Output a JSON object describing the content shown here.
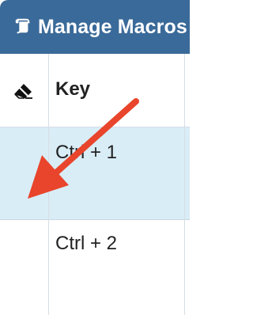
{
  "window": {
    "title": "Manage Macros"
  },
  "icons": {
    "title_icon": "scroll-icon",
    "clear_icon": "eraser-icon"
  },
  "table": {
    "columns": [
      "",
      "Key"
    ],
    "rows": [
      {
        "key": "Ctrl + 1",
        "selected": true
      },
      {
        "key": "Ctrl + 2",
        "selected": false
      }
    ]
  },
  "colors": {
    "titlebar": "#3a6a99",
    "selected_row": "#d9edf7",
    "arrow": "#e8452c"
  }
}
